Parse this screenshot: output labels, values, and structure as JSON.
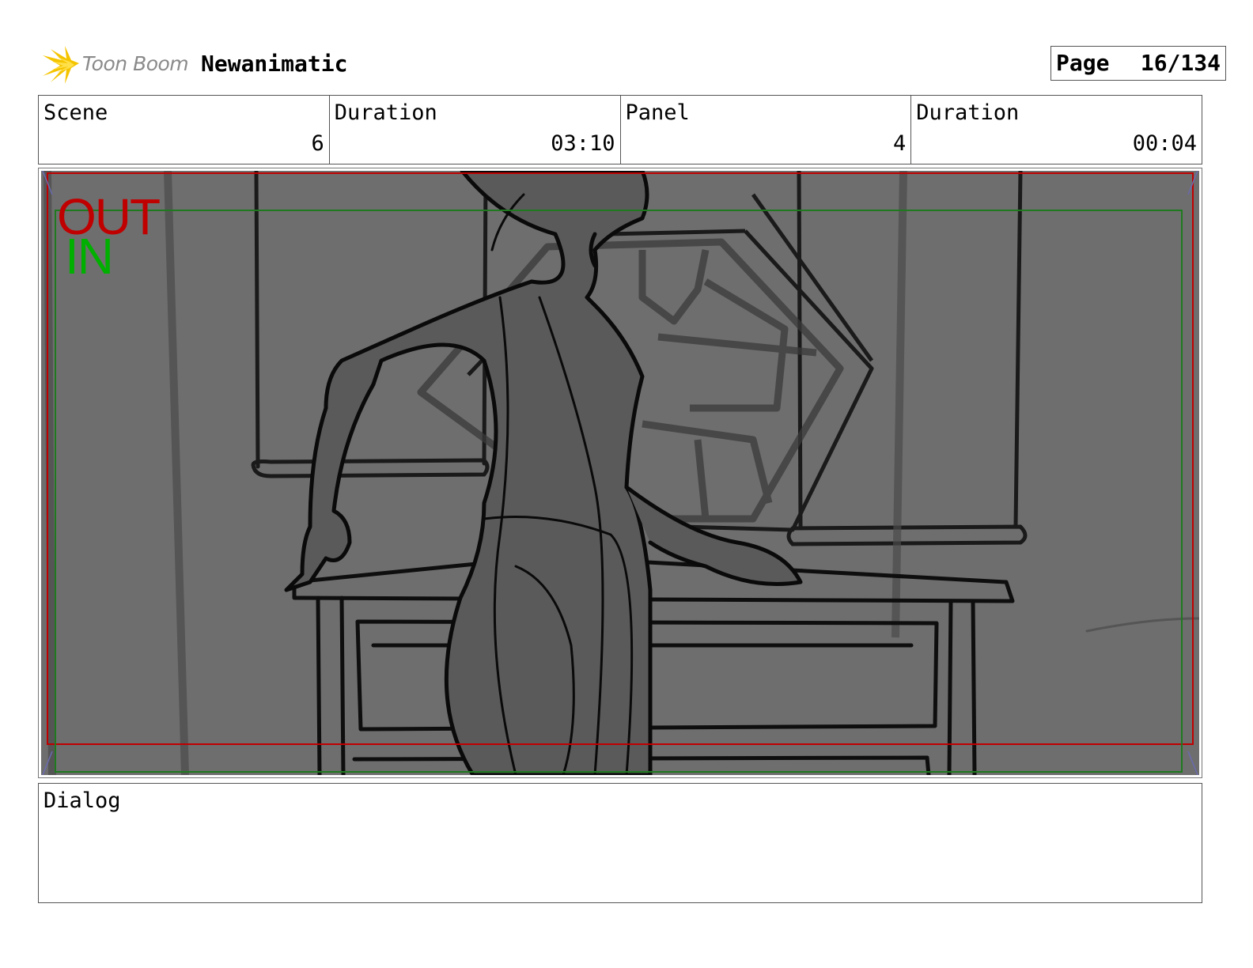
{
  "header": {
    "brand": "Toon Boom",
    "project_title": "Newanimatic",
    "page_label": "Page",
    "page_number": "16/134"
  },
  "info": {
    "scene_label": "Scene",
    "scene_value": "6",
    "scene_duration_label": "Duration",
    "scene_duration_value": "03:10",
    "panel_label": "Panel",
    "panel_value": "4",
    "panel_duration_label": "Duration",
    "panel_duration_value": "00:04"
  },
  "frame": {
    "out_label": "OUT",
    "in_label": "IN",
    "out_color": "#c00000",
    "in_color": "#00b000"
  },
  "dialog": {
    "label": "Dialog",
    "text": ""
  }
}
